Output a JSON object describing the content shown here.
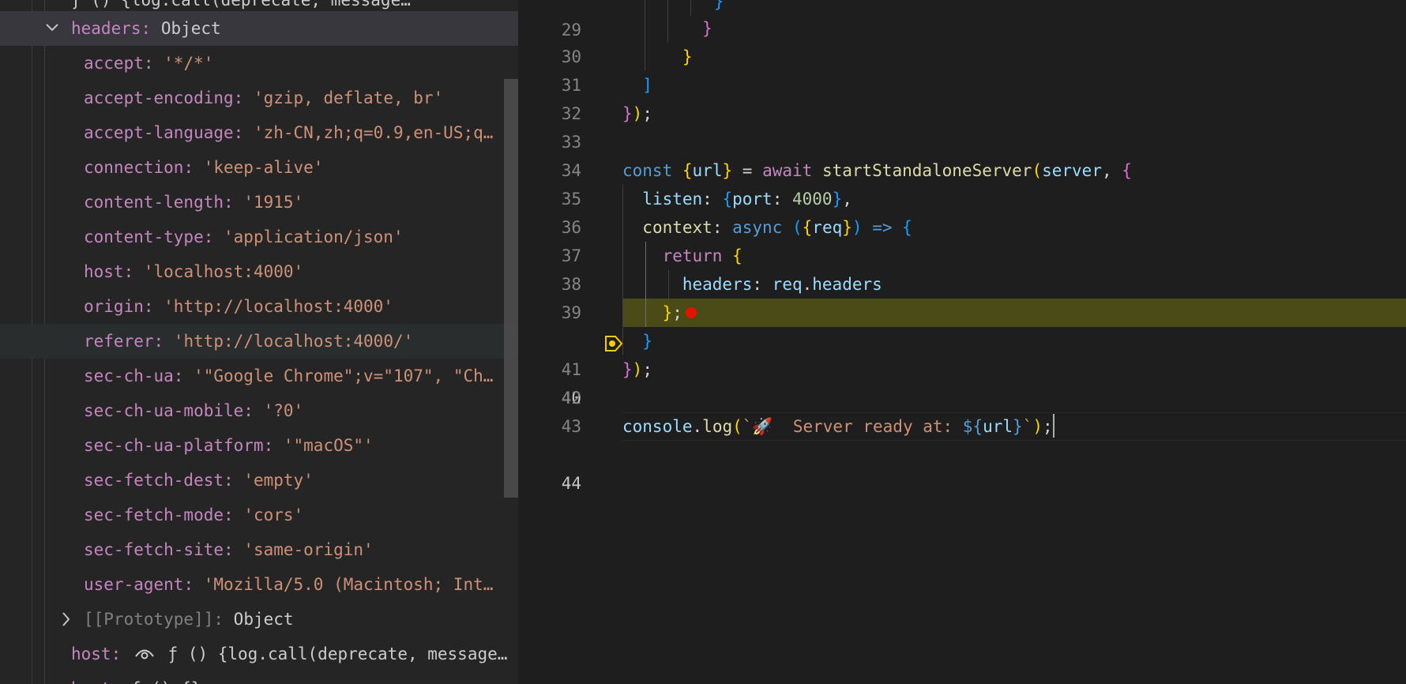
{
  "variables": {
    "headers_label": "headers",
    "headers_type": "Object",
    "items": [
      {
        "key": "accept",
        "value": "'*/*'"
      },
      {
        "key": "accept-encoding",
        "value": "'gzip, deflate, br'"
      },
      {
        "key": "accept-language",
        "value": "'zh-CN,zh;q=0.9,en-US;q…"
      },
      {
        "key": "connection",
        "value": "'keep-alive'"
      },
      {
        "key": "content-length",
        "value": "'1915'"
      },
      {
        "key": "content-type",
        "value": "'application/json'"
      },
      {
        "key": "host",
        "value": "'localhost:4000'"
      },
      {
        "key": "origin",
        "value": "'http://localhost:4000'"
      },
      {
        "key": "referer",
        "value": "'http://localhost:4000/'"
      },
      {
        "key": "sec-ch-ua",
        "value": "'\"Google Chrome\";v=\"107\", \"Ch…"
      },
      {
        "key": "sec-ch-ua-mobile",
        "value": "'?0'"
      },
      {
        "key": "sec-ch-ua-platform",
        "value": "'\"macOS\"'"
      },
      {
        "key": "sec-fetch-dest",
        "value": "'empty'"
      },
      {
        "key": "sec-fetch-mode",
        "value": "'cors'"
      },
      {
        "key": "sec-fetch-site",
        "value": "'same-origin'"
      },
      {
        "key": "user-agent",
        "value": "'Mozilla/5.0 (Macintosh; Int…"
      }
    ],
    "prototype_label": "[[Prototype]]",
    "prototype_type": "Object",
    "host_getter_label": "host",
    "host_getter_value": "ƒ () {log.call(deprecate, message…"
  },
  "editor": {
    "active_line": 44,
    "paused_line": 40,
    "line_numbers": [
      "29",
      "30",
      "31",
      "32",
      "33",
      "34",
      "35",
      "36",
      "37",
      "38",
      "39",
      "40",
      "41",
      "42",
      "43",
      "44"
    ]
  },
  "colors": {
    "background": "#1e1e1e",
    "panel": "#252526",
    "paused_line_highlight": "#4b4b18",
    "breakpoint": "#e51400",
    "stopped_marker": "#ffcc00"
  }
}
